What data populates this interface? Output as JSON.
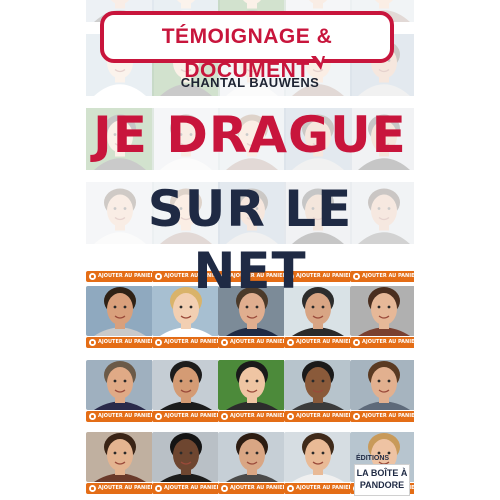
{
  "cover": {
    "genre": "TÉMOIGNAGE & DOCUMENT",
    "author": "CHANTAL BAUWENS",
    "title_line1": "JE DRAGUE",
    "title_line2": "SUR LE NET"
  },
  "profile_card": {
    "cta_label": "AJOUTER AU PANIER"
  },
  "publisher": {
    "editions": "ÉDITIONS",
    "line1": "LA BOÎTE À",
    "line2": "PANDORE"
  },
  "colors": {
    "accent_red": "#c8153c",
    "navy": "#1f2a44",
    "cta_orange": "#e46d16"
  },
  "profile_rows": [
    {
      "row": 1,
      "tiles": [
        {
          "skin": "#e7b89a",
          "hair": "#6a4a2a",
          "bg": "#b9c7d6",
          "shirt": "#3b3b3b"
        },
        {
          "skin": "#f0c9a8",
          "hair": "#d8b46a",
          "bg": "#9fb5c7",
          "shirt": "#e0e0e0"
        },
        {
          "skin": "#d9a78a",
          "hair": "#5a3a22",
          "bg": "#c4b9a2",
          "shirt": "#4a4a4a"
        },
        {
          "skin": "#e6b391",
          "hair": "#3c2a1c",
          "bg": "#b8c6cf",
          "shirt": "#6b7f8f"
        },
        {
          "skin": "#eebd98",
          "hair": "#7d4e2a",
          "bg": "#c9d2d9",
          "shirt": "#8a6a5a"
        }
      ]
    },
    {
      "row": 2,
      "tiles": [
        {
          "skin": "#d9a07c",
          "hair": "#2f2216",
          "bg": "#8fa9bf",
          "shirt": "#c9c9c9"
        },
        {
          "skin": "#f2cfb2",
          "hair": "#d9b36a",
          "bg": "#a7bfd1",
          "shirt": "#ffffff"
        },
        {
          "skin": "#e0ae8f",
          "hair": "#4b3a2a",
          "bg": "#7c8b98",
          "shirt": "#1f2a44"
        },
        {
          "skin": "#d8a584",
          "hair": "#2c2c2c",
          "bg": "#d9e2e6",
          "shirt": "#2a2a2a"
        },
        {
          "skin": "#e6b898",
          "hair": "#4a2e1f",
          "bg": "#b0b0b0",
          "shirt": "#7a4030"
        }
      ]
    },
    {
      "row": 3,
      "tiles": [
        {
          "skin": "#e0aa86",
          "hair": "#6b5a48",
          "bg": "#9fb0bf",
          "shirt": "#2a2a4a"
        },
        {
          "skin": "#d49b74",
          "hair": "#1c1c1c",
          "bg": "#c5cdd4",
          "shirt": "#1c1c1c"
        },
        {
          "skin": "#efc5a3",
          "hair": "#1a1a1a",
          "bg": "#4c8a3a",
          "shirt": "#2c2c2c"
        },
        {
          "skin": "#8a5a3a",
          "hair": "#1a1a1a",
          "bg": "#b7c4cc",
          "shirt": "#3b3b3b"
        },
        {
          "skin": "#e2b08f",
          "hair": "#5a3a22",
          "bg": "#a6b4bf",
          "shirt": "#5e6a7a"
        }
      ]
    },
    {
      "row": 4,
      "tiles": [
        {
          "skin": "#e4b490",
          "hair": "#3a2416",
          "bg": "#c0b0a0",
          "shirt": "#6a3a2a"
        },
        {
          "skin": "#6e4630",
          "hair": "#141414",
          "bg": "#b9c0c6",
          "shirt": "#1c1c1c"
        },
        {
          "skin": "#d9a684",
          "hair": "#2c1c12",
          "bg": "#c6cfd6",
          "shirt": "#4a4a4a"
        },
        {
          "skin": "#e9ba96",
          "hair": "#3f2a1a",
          "bg": "#d6dde2",
          "shirt": "#f0f0f0"
        },
        {
          "skin": "#eec3a3",
          "hair": "#c89a5a",
          "bg": "#b7c5cf",
          "shirt": "#7f8f9f"
        }
      ]
    }
  ]
}
